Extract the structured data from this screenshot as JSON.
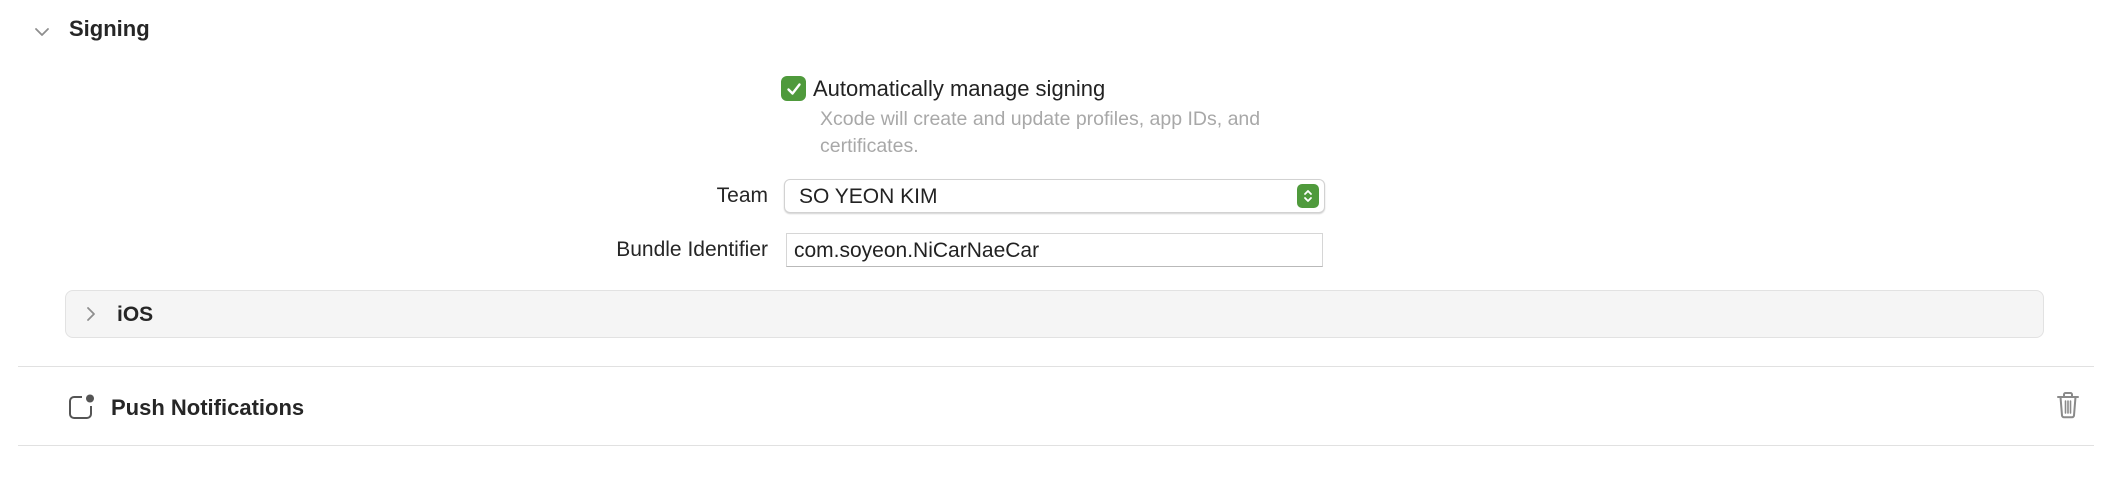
{
  "signing": {
    "title": "Signing",
    "auto_manage_label": "Automatically manage signing",
    "auto_manage_checked": true,
    "auto_manage_hint": "Xcode will create and update profiles, app IDs, and certificates.",
    "team_label": "Team",
    "team_value": "SO YEON KIM",
    "bundle_label": "Bundle Identifier",
    "bundle_value": "com.soyeon.NiCarNaeCar"
  },
  "platform_group": {
    "label": "iOS"
  },
  "capability": {
    "title": "Push Notifications"
  },
  "colors": {
    "accent_green": "#4f9a3c"
  }
}
